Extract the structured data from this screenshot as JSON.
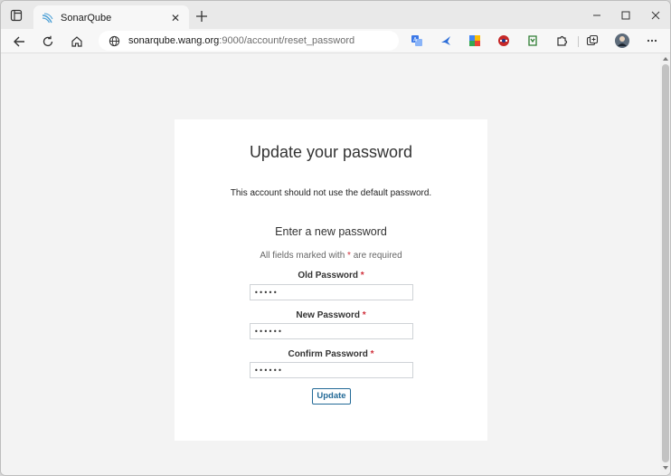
{
  "browser": {
    "tab": {
      "title": "SonarQube",
      "close_glyph": "✕",
      "favicon_color": "#4b9fd5"
    },
    "new_tab_glyph": "+",
    "window_controls": {
      "minimize": "—",
      "maximize": "☐",
      "close": "✕"
    },
    "address": {
      "host": "sonarqube.wang.org",
      "path": ":9000/account/reset_password"
    },
    "icons": {
      "tab_actions": "tab-actions-icon",
      "back": "back-arrow-icon",
      "refresh": "refresh-icon",
      "home": "home-icon",
      "site_info": "globe-icon",
      "extensions": [
        "translate-icon",
        "bird-extension-icon",
        "puzzle-color-icon",
        "shield-extension-icon",
        "save-extension-icon",
        "extensions-icon",
        "collections-icon",
        "profile-avatar"
      ],
      "menu": "more-menu-icon"
    }
  },
  "page": {
    "title": "Update your password",
    "notice": "This account should not use the default password.",
    "subtitle": "Enter a new password",
    "required_prefix": "All fields marked with",
    "required_star": "*",
    "required_suffix": "are required",
    "fields": [
      {
        "label": "Old Password",
        "star": "*",
        "value": "•••••"
      },
      {
        "label": "New Password",
        "star": "*",
        "value": "••••••"
      },
      {
        "label": "Confirm Password",
        "star": "*",
        "value": "••••••"
      }
    ],
    "submit_label": "Update"
  },
  "colors": {
    "accent": "#236a97",
    "required": "#d02f3a",
    "page_bg": "#f3f3f3",
    "card_bg": "#ffffff"
  }
}
